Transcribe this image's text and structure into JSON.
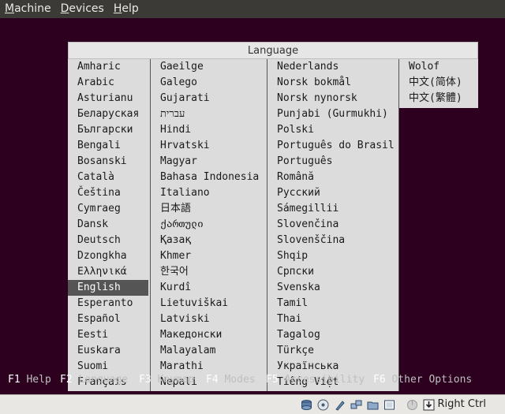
{
  "menubar": {
    "items": [
      "Machine",
      "Devices",
      "Help"
    ]
  },
  "dialog": {
    "title": "Language",
    "columns": [
      [
        "Amharic",
        "Arabic",
        "Asturianu",
        "Беларуская",
        "Български",
        "Bengali",
        "Bosanski",
        "Català",
        "Čeština",
        "Cymraeg",
        "Dansk",
        "Deutsch",
        "Dzongkha",
        "Ελληνικά",
        "English",
        "Esperanto",
        "Español",
        "Eesti",
        "Euskara",
        "Suomi",
        "Français"
      ],
      [
        "Gaeilge",
        "Galego",
        "Gujarati",
        "עברית",
        "Hindi",
        "Hrvatski",
        "Magyar",
        "Bahasa Indonesia",
        "Italiano",
        "日本語",
        "ქართული",
        "Қазақ",
        "Khmer",
        "한국어",
        "Kurdî",
        "Lietuviškai",
        "Latviski",
        "Македонски",
        "Malayalam",
        "Marathi",
        "Nepali"
      ],
      [
        "Nederlands",
        "Norsk bokmål",
        "Norsk nynorsk",
        "Punjabi (Gurmukhi)",
        "Polski",
        "Português do Brasil",
        "Português",
        "Română",
        "Русский",
        "Sámegillii",
        "Slovenčina",
        "Slovenščina",
        "Shqip",
        "Српски",
        "Svenska",
        "Tamil",
        "Thai",
        "Tagalog",
        "Türkçe",
        "Українська",
        "Tiếng Việt"
      ],
      [
        "Wolof",
        "中文(简体)",
        "中文(繁體)"
      ]
    ],
    "selected": "English"
  },
  "fkeys": [
    {
      "key": "F1",
      "label": "Help"
    },
    {
      "key": "F2",
      "label": "Language"
    },
    {
      "key": "F3",
      "label": "Keymap"
    },
    {
      "key": "F4",
      "label": "Modes"
    },
    {
      "key": "F5",
      "label": "Accessibility"
    },
    {
      "key": "F6",
      "label": "Other Options"
    }
  ],
  "statusbar": {
    "icons": [
      "hard-disk-icon",
      "optical-drive-icon",
      "usb-icon",
      "network-icon",
      "shared-folder-icon",
      "display-icon",
      "mouse-integration-icon",
      "keyboard-capture-icon"
    ],
    "host_key": "Right Ctrl"
  }
}
